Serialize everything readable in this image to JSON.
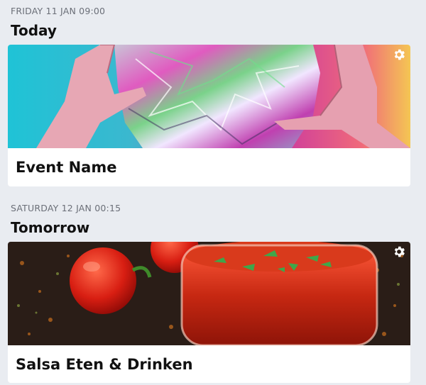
{
  "events": [
    {
      "date_line": "FRIDAY 11 JAN 09:00",
      "day_label": "Today",
      "event_name": "Event Name",
      "settings_icon": "gear-icon",
      "image_subject": "hands-holding-crumpled-foil"
    },
    {
      "date_line": "SATURDAY 12 JAN 00:15",
      "day_label": "Tomorrow",
      "event_name": "Salsa Eten & Drinken",
      "settings_icon": "gear-icon",
      "image_subject": "tomato-salsa-jar"
    }
  ],
  "colors": {
    "page_background": "#e9ecf1",
    "card_background": "#ffffff",
    "date_text": "#6b6f78",
    "title_text": "#111111",
    "icon": "#ffffff"
  }
}
